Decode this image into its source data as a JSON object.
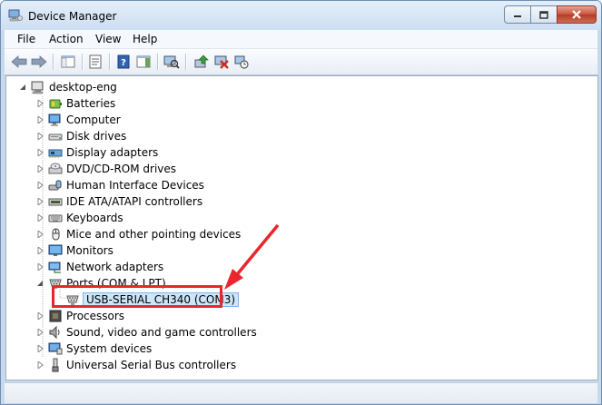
{
  "window": {
    "title": "Device Manager"
  },
  "menu": [
    "File",
    "Action",
    "View",
    "Help"
  ],
  "tree": {
    "root": "desktop-eng",
    "categories": [
      {
        "label": "Batteries",
        "icon": "battery-icon",
        "expanded": false
      },
      {
        "label": "Computer",
        "icon": "computer-icon",
        "expanded": false
      },
      {
        "label": "Disk drives",
        "icon": "disk-drive-icon",
        "expanded": false
      },
      {
        "label": "Display adapters",
        "icon": "display-adapter-icon",
        "expanded": false
      },
      {
        "label": "DVD/CD-ROM drives",
        "icon": "dvd-drive-icon",
        "expanded": false
      },
      {
        "label": "Human Interface Devices",
        "icon": "hid-icon",
        "expanded": false
      },
      {
        "label": "IDE ATA/ATAPI controllers",
        "icon": "ide-controller-icon",
        "expanded": false
      },
      {
        "label": "Keyboards",
        "icon": "keyboard-icon",
        "expanded": false
      },
      {
        "label": "Mice and other pointing devices",
        "icon": "mouse-icon",
        "expanded": false
      },
      {
        "label": "Monitors",
        "icon": "monitor-icon",
        "expanded": false
      },
      {
        "label": "Network adapters",
        "icon": "network-adapter-icon",
        "expanded": false
      },
      {
        "label": "Ports (COM & LPT)",
        "icon": "port-icon",
        "expanded": true,
        "children": [
          {
            "label": "USB-SERIAL CH340 (COM3)",
            "icon": "port-icon",
            "selected": true
          }
        ]
      },
      {
        "label": "Processors",
        "icon": "processor-icon",
        "expanded": false
      },
      {
        "label": "Sound, video and game controllers",
        "icon": "sound-icon",
        "expanded": false
      },
      {
        "label": "System devices",
        "icon": "system-device-icon",
        "expanded": false
      },
      {
        "label": "Universal Serial Bus controllers",
        "icon": "usb-icon",
        "expanded": false
      }
    ]
  },
  "colors": {
    "highlight": "#e8262b",
    "selection": "#cde6f7"
  }
}
